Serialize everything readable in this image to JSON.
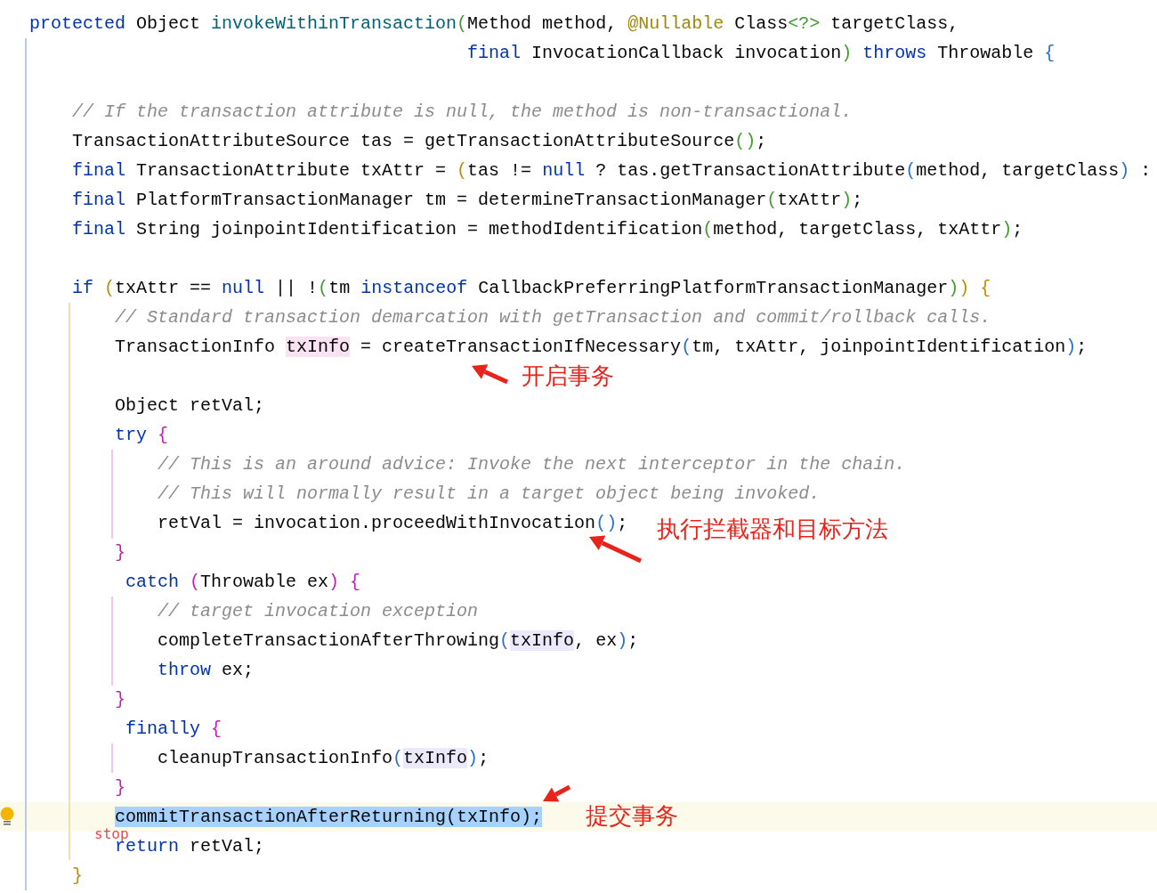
{
  "lines": [
    {
      "kind": "code",
      "current": false,
      "tokens": [
        {
          "kind": "kw",
          "text": "protected"
        },
        {
          "kind": "id",
          "text": " Object "
        },
        {
          "kind": "fn",
          "text": "invokeWithinTransaction"
        },
        {
          "kind": "p2",
          "text": "("
        },
        {
          "kind": "id",
          "text": "Method method, "
        },
        {
          "kind": "ann",
          "text": "@Nullable"
        },
        {
          "kind": "id",
          "text": " Class"
        },
        {
          "kind": "p2",
          "text": "<?>"
        },
        {
          "kind": "id",
          "text": " targetClass,"
        }
      ]
    },
    {
      "kind": "code",
      "current": false,
      "tokens": [
        {
          "kind": "kw",
          "text": "                                         final"
        },
        {
          "kind": "id",
          "text": " InvocationCallback invocation"
        },
        {
          "kind": "p2",
          "text": ")"
        },
        {
          "kind": "kw",
          "text": " throws"
        },
        {
          "kind": "id",
          "text": " Throwable "
        },
        {
          "kind": "p3",
          "text": "{"
        }
      ]
    },
    {
      "kind": "blank",
      "current": false
    },
    {
      "kind": "code",
      "current": false,
      "tokens": [
        {
          "kind": "cm",
          "text": "    // If the transaction attribute is null, the method is non-transactional."
        }
      ]
    },
    {
      "kind": "code",
      "current": false,
      "tokens": [
        {
          "kind": "id",
          "text": "    TransactionAttributeSource tas = getTransactionAttributeSource"
        },
        {
          "kind": "p2",
          "text": "()"
        },
        {
          "kind": "id",
          "text": ";"
        }
      ]
    },
    {
      "kind": "code",
      "current": false,
      "tokens": [
        {
          "kind": "kw",
          "text": "    final"
        },
        {
          "kind": "id",
          "text": " TransactionAttribute txAttr = "
        },
        {
          "kind": "p1",
          "text": "("
        },
        {
          "kind": "id",
          "text": "tas != "
        },
        {
          "kind": "kw",
          "text": "null"
        },
        {
          "kind": "id",
          "text": " ? tas.getTransactionAttribute"
        },
        {
          "kind": "p3",
          "text": "("
        },
        {
          "kind": "id",
          "text": "method, targetClass"
        },
        {
          "kind": "p3",
          "text": ")"
        },
        {
          "kind": "id",
          "text": " :"
        }
      ]
    },
    {
      "kind": "code",
      "current": false,
      "tokens": [
        {
          "kind": "kw",
          "text": "    final"
        },
        {
          "kind": "id",
          "text": " PlatformTransactionManager tm = determineTransactionManager"
        },
        {
          "kind": "p2",
          "text": "("
        },
        {
          "kind": "id",
          "text": "txAttr"
        },
        {
          "kind": "p2",
          "text": ")"
        },
        {
          "kind": "id",
          "text": ";"
        }
      ]
    },
    {
      "kind": "code",
      "current": false,
      "tokens": [
        {
          "kind": "kw",
          "text": "    final"
        },
        {
          "kind": "id",
          "text": " String joinpointIdentification = methodIdentification"
        },
        {
          "kind": "p2",
          "text": "("
        },
        {
          "kind": "id",
          "text": "method, targetClass, txAttr"
        },
        {
          "kind": "p2",
          "text": ")"
        },
        {
          "kind": "id",
          "text": ";"
        }
      ]
    },
    {
      "kind": "blank",
      "current": false
    },
    {
      "kind": "code",
      "current": false,
      "tokens": [
        {
          "kind": "kw",
          "text": "    if"
        },
        {
          "kind": "p1",
          "text": " ("
        },
        {
          "kind": "id",
          "text": "txAttr == "
        },
        {
          "kind": "kw",
          "text": "null"
        },
        {
          "kind": "id",
          "text": " || !"
        },
        {
          "kind": "p2",
          "text": "("
        },
        {
          "kind": "id",
          "text": "tm "
        },
        {
          "kind": "kw",
          "text": "instanceof"
        },
        {
          "kind": "id",
          "text": " CallbackPreferringPlatformTransactionManager"
        },
        {
          "kind": "p2",
          "text": ")"
        },
        {
          "kind": "p1",
          "text": ") {"
        }
      ]
    },
    {
      "kind": "code",
      "current": false,
      "tokens": [
        {
          "kind": "cm",
          "text": "        // Standard transaction demarcation with getTransaction and commit/rollback calls."
        }
      ]
    },
    {
      "kind": "code",
      "current": false,
      "tokens": [
        {
          "kind": "id",
          "text": "        TransactionInfo "
        },
        {
          "kind": "id",
          "write_usage": true,
          "text": "txInfo"
        },
        {
          "kind": "id",
          "text": " = createTransactionIfNecessary"
        },
        {
          "kind": "p3",
          "text": "("
        },
        {
          "kind": "id",
          "text": "tm, txAttr, joinpointIdentification"
        },
        {
          "kind": "p3",
          "text": ")"
        },
        {
          "kind": "id",
          "text": ";"
        }
      ]
    },
    {
      "kind": "blank",
      "current": false
    },
    {
      "kind": "code",
      "current": false,
      "tokens": [
        {
          "kind": "id",
          "text": "        Object retVal;"
        }
      ]
    },
    {
      "kind": "code",
      "current": false,
      "tokens": [
        {
          "kind": "kw",
          "text": "        try"
        },
        {
          "kind": "p4",
          "text": " {"
        }
      ]
    },
    {
      "kind": "code",
      "current": false,
      "tokens": [
        {
          "kind": "cm",
          "text": "            // This is an around advice: Invoke the next interceptor in the chain."
        }
      ]
    },
    {
      "kind": "code",
      "current": false,
      "tokens": [
        {
          "kind": "cm",
          "text": "            // This will normally result in a target object being invoked."
        }
      ]
    },
    {
      "kind": "code",
      "current": false,
      "tokens": [
        {
          "kind": "id",
          "text": "            retVal = invocation.proceedWithInvocation"
        },
        {
          "kind": "p3",
          "text": "()"
        },
        {
          "kind": "id",
          "text": ";"
        }
      ]
    },
    {
      "kind": "code",
      "current": false,
      "tokens": [
        {
          "kind": "p4",
          "text": "        }"
        }
      ]
    },
    {
      "kind": "code",
      "current": false,
      "tokens": [
        {
          "kind": "kw",
          "text": "         catch"
        },
        {
          "kind": "p4",
          "text": " ("
        },
        {
          "kind": "id",
          "text": "Throwable ex"
        },
        {
          "kind": "p4",
          "text": ") {"
        }
      ]
    },
    {
      "kind": "code",
      "current": false,
      "tokens": [
        {
          "kind": "cm",
          "text": "            // target invocation exception"
        }
      ]
    },
    {
      "kind": "code",
      "current": false,
      "tokens": [
        {
          "kind": "id",
          "text": "            completeTransactionAfterThrowing"
        },
        {
          "kind": "p3",
          "text": "("
        },
        {
          "kind": "id",
          "read_usage": true,
          "text": "txInfo"
        },
        {
          "kind": "id",
          "text": ", ex"
        },
        {
          "kind": "p3",
          "text": ")"
        },
        {
          "kind": "id",
          "text": ";"
        }
      ]
    },
    {
      "kind": "code",
      "current": false,
      "tokens": [
        {
          "kind": "kw",
          "text": "            throw"
        },
        {
          "kind": "id",
          "text": " ex;"
        }
      ]
    },
    {
      "kind": "code",
      "current": false,
      "tokens": [
        {
          "kind": "p4",
          "text": "        }"
        }
      ]
    },
    {
      "kind": "code",
      "current": false,
      "tokens": [
        {
          "kind": "kw",
          "text": "         finally"
        },
        {
          "kind": "p4",
          "text": " {"
        }
      ]
    },
    {
      "kind": "code",
      "current": false,
      "tokens": [
        {
          "kind": "id",
          "text": "            cleanupTransactionInfo"
        },
        {
          "kind": "p3",
          "text": "("
        },
        {
          "kind": "id",
          "read_usage": true,
          "text": "txInfo"
        },
        {
          "kind": "p3",
          "text": ")"
        },
        {
          "kind": "id",
          "text": ";"
        }
      ]
    },
    {
      "kind": "code",
      "current": false,
      "tokens": [
        {
          "kind": "p4",
          "text": "        }"
        }
      ]
    },
    {
      "kind": "code",
      "current": true,
      "bulb": true,
      "tokens": [
        {
          "kind": "id",
          "selected": true,
          "text": "        commitTransactionAfterReturning(txInfo);"
        }
      ]
    },
    {
      "kind": "code",
      "current": false,
      "tokens": [
        {
          "kind": "kw",
          "text": "        return"
        },
        {
          "kind": "id",
          "text": " retVal;"
        }
      ]
    },
    {
      "kind": "code",
      "current": false,
      "tokens": [
        {
          "kind": "p1",
          "text": "    }"
        }
      ]
    }
  ],
  "stop_label": "stop",
  "annotations": [
    {
      "text": "开启事务"
    },
    {
      "text": "执行拦截器和目标方法"
    },
    {
      "text": "提交事务"
    }
  ]
}
